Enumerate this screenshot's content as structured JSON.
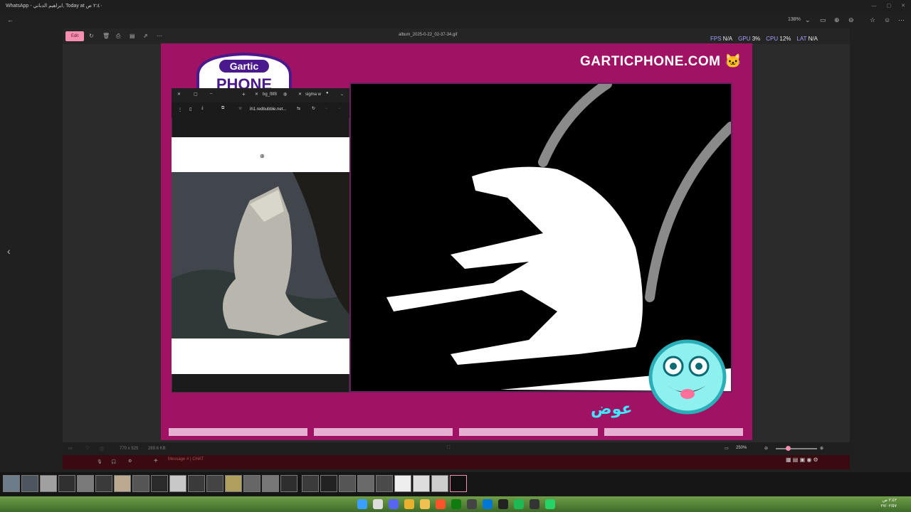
{
  "window": {
    "title": "WhatsApp - ابراهيم الدباني, Today at ٢:٤٠ ص",
    "controls": [
      "—",
      "▢",
      "✕"
    ]
  },
  "topbar": {
    "zoom": "138%",
    "back_icon": "arrow-left-icon"
  },
  "viewer": {
    "edit_label": "Edit",
    "file_name": "album_2025-0-22_02-37-34.gif",
    "nav_prev": "‹",
    "status_dims": "770 x 525",
    "status_size": "289.6 KB",
    "zoom_level": "250%"
  },
  "perf": {
    "fps_label": "FPS",
    "fps_value": "N/A",
    "gpu_label": "GPU",
    "gpu_value": "3%",
    "cpu_label": "CPU",
    "cpu_value": "12%",
    "lat_label": "LAT",
    "lat_value": "N/A"
  },
  "game": {
    "logo_top": "Gartic",
    "logo_bottom": "PHONE",
    "site": "GARTICPHONE.COM",
    "answer": "عوض",
    "progress_segments": 4
  },
  "popup": {
    "tab1": "bg_f8f8",
    "tab2": "sigma w",
    "url": "ih1.redbubble.net..."
  },
  "discord": {
    "placeholder": "Message # | CHAT"
  },
  "clock": {
    "time": "٢:٤٢ ص",
    "date": "٢٧/٠٢/٥٧"
  },
  "colors": {
    "game_bg": "#a01263",
    "edit_btn": "#f48fb1",
    "answer": "#3ee8ff"
  }
}
